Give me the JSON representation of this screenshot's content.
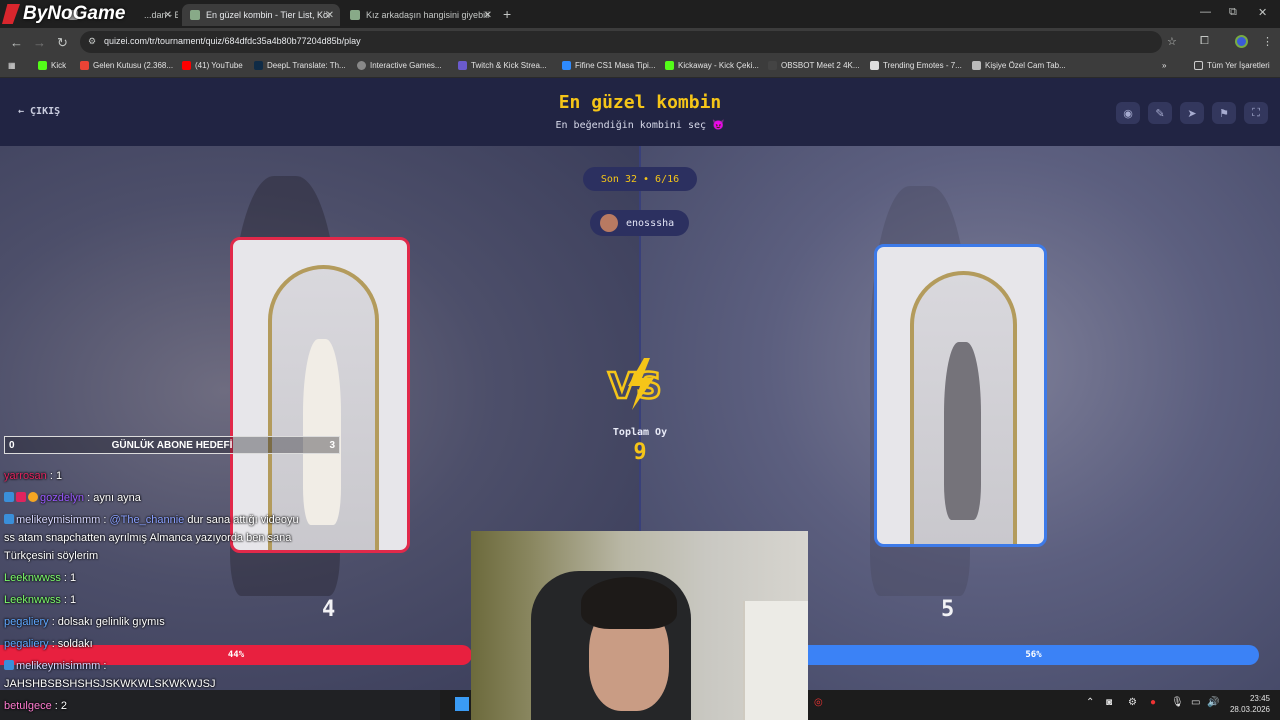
{
  "browser": {
    "logo_text": "ByNoGame",
    "tabs": [
      {
        "label": "...dan - B",
        "active": false
      },
      {
        "label": "En güzel kombin - Tier List, Kör",
        "active": true
      },
      {
        "label": "Kız arkadaşın hangisini giyebili",
        "active": false
      }
    ],
    "url": "quizei.com/tr/tournament/quiz/684dfdc35a4b80b77204d85b/play",
    "bookmarks": [
      "Kick",
      "Gelen Kutusu (2.368...",
      "(41) YouTube",
      "DeepL Translate: Th...",
      "Interactive Games...",
      "Twitch & Kick Strea...",
      "Fifine CS1 Masa Tipi...",
      "Kickaway - Kick Çeki...",
      "OBSBOT Meet 2 4K...",
      "Trending Emotes - 7...",
      "Kişiye Özel Cam Tab..."
    ],
    "all_bookmarks": "Tüm Yer İşaretleri"
  },
  "quiz": {
    "exit_label": "ÇIKIŞ",
    "title": "En güzel kombin",
    "subtitle": "En beğendiğin kombini seç 😈",
    "round": "Son 32 • 6/16",
    "username": "enosssha",
    "total_label": "Toplam Oy",
    "total_votes": "9",
    "left": {
      "score": "4",
      "percent_label": "44%",
      "percent": 44
    },
    "right": {
      "score": "5",
      "percent_label": "56%",
      "percent": 56
    }
  },
  "overlay": {
    "goal": {
      "left": "0",
      "label": "GÜNLÜK ABONE HEDEFİ",
      "right": "3"
    },
    "chat": [
      {
        "user": "yarrosan",
        "text": " : 1",
        "color": "#e0245e"
      },
      {
        "user": "gozdelyn",
        "text": " : aynı ayna",
        "color": "#9b59ff"
      },
      {
        "user": "melikeymisimmm",
        "text": " : ",
        "mention": "@The_channie",
        "text2": " dur sana attığı videoyu",
        "color": "#d6d6ff"
      },
      {
        "user": "",
        "text": "ss atam snapchatten ayrılmış Almanca yazıyorda ben sana",
        "color": "#ffffff"
      },
      {
        "user": "",
        "text": "Türkçesini söylerim",
        "color": "#ffffff"
      },
      {
        "user": "Leeknwwss",
        "text": " : 1",
        "color": "#7cfc6a"
      },
      {
        "user": "Leeknwwss",
        "text": " : 1",
        "color": "#7cfc6a"
      },
      {
        "user": "pegaliery",
        "text": " : dolsakı gelinlik gıymıs",
        "color": "#5fa8ff"
      },
      {
        "user": "pegaliery",
        "text": " : soldakı",
        "color": "#5fa8ff"
      },
      {
        "user": "melikeymisimmm",
        "text": " :",
        "color": "#d6d6ff"
      },
      {
        "user": "",
        "text": "JAHSHBSBSHSHSJSKWKWLSKWKWJSJ",
        "color": "#ffffff"
      },
      {
        "user": "betulgece",
        "text": " : 2",
        "color": "#ff7bd0"
      }
    ]
  },
  "system": {
    "time": "23:45",
    "date": "28.03.2026"
  },
  "colors": {
    "accent_yellow": "#f5c518",
    "left_red": "#e8203f",
    "right_blue": "#3b82f6"
  }
}
